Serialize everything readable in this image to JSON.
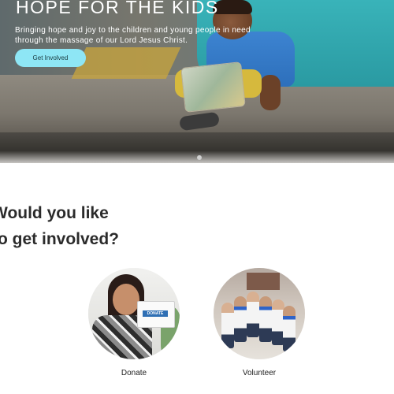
{
  "hero": {
    "title": "HOPE FOR THE KIDS",
    "text": "Bringing hope and joy to the children and young people in need through the massage of our Lord Jesus Christ.",
    "button_label": "Get Involved",
    "accent_color": "#8ee6f5"
  },
  "section": {
    "line1": "Would you like",
    "line2": "to get involved?"
  },
  "options": {
    "donate": {
      "label": "Donate",
      "box_text": "DONATE"
    },
    "volunteer": {
      "label": "Volunteer"
    }
  }
}
